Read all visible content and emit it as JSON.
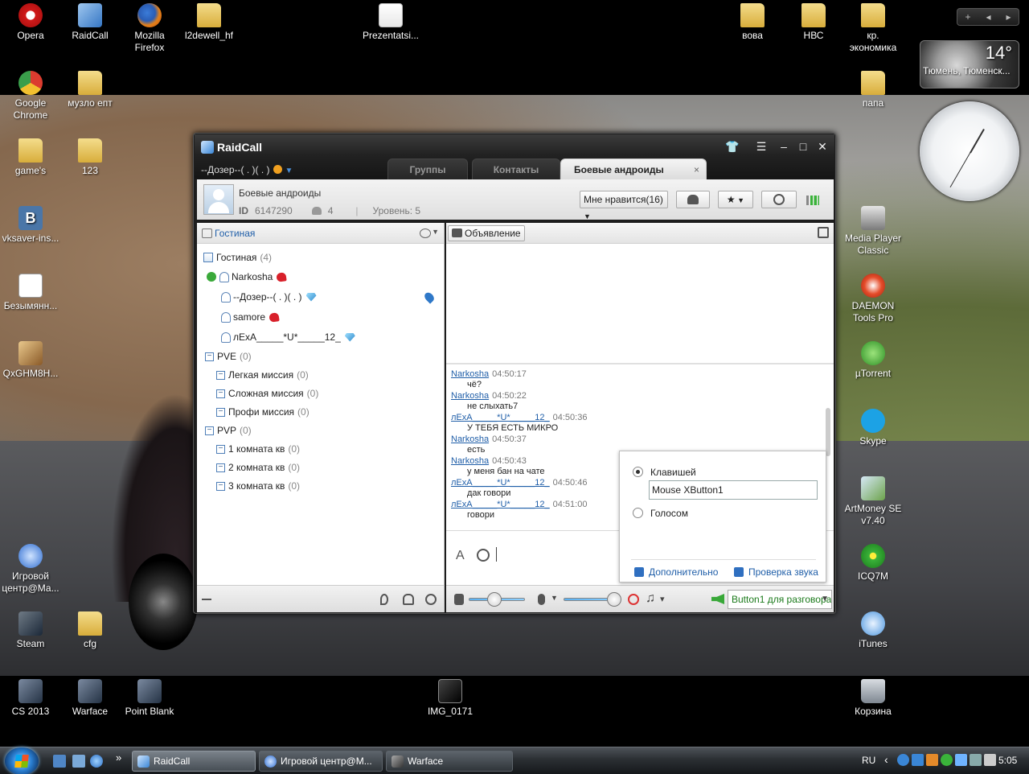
{
  "desktop": {
    "icons_left": [
      {
        "label": "Opera",
        "icon": "opera-icon"
      },
      {
        "label": "RaidCall",
        "icon": "raidcall-icon"
      },
      {
        "label": "Mozilla Firefox",
        "icon": "firefox-icon"
      },
      {
        "label": "l2dewell_hf",
        "icon": "folder-icon"
      },
      {
        "label": "Prezentatsi...",
        "icon": "powerpoint-file-icon"
      },
      {
        "label": "Google Chrome",
        "icon": "chrome-icon"
      },
      {
        "label": "музло епт",
        "icon": "folder-icon"
      },
      {
        "label": "game's",
        "icon": "folder-icon"
      },
      {
        "label": "123",
        "icon": "folder-icon"
      },
      {
        "label": "vksaver-ins...",
        "icon": "vk-icon"
      },
      {
        "label": "Безымянн...",
        "icon": "image-file-icon"
      },
      {
        "label": "QxGHM8H...",
        "icon": "image-file-icon"
      },
      {
        "label": "Игровой центр@Ма...",
        "icon": "game-center-icon"
      },
      {
        "label": "Steam",
        "icon": "steam-icon"
      },
      {
        "label": "cfg",
        "icon": "folder-icon"
      },
      {
        "label": "CS 2013",
        "icon": "cs-icon"
      },
      {
        "label": "Warface",
        "icon": "warface-icon"
      },
      {
        "label": "Point Blank",
        "icon": "point-blank-icon"
      },
      {
        "label": "IMG_0171",
        "icon": "video-file-icon"
      }
    ],
    "icons_right": [
      {
        "label": "вова",
        "icon": "folder-icon"
      },
      {
        "label": "НВС",
        "icon": "folder-icon"
      },
      {
        "label": "кр. экономика",
        "icon": "folder-icon"
      },
      {
        "label": "папа",
        "icon": "folder-icon"
      },
      {
        "label": "Media Player Classic",
        "icon": "mpc-icon"
      },
      {
        "label": "DAEMON Tools Pro",
        "icon": "daemon-tools-icon"
      },
      {
        "label": "µTorrent",
        "icon": "utorrent-icon"
      },
      {
        "label": "Skype",
        "icon": "skype-icon"
      },
      {
        "label": "ArtMoney SE v7.40",
        "icon": "artmoney-icon"
      },
      {
        "label": "ICQ7M",
        "icon": "icq-icon"
      },
      {
        "label": "iTunes",
        "icon": "itunes-icon"
      },
      {
        "label": "Корзина",
        "icon": "recycle-bin-icon"
      }
    ]
  },
  "gadgets": {
    "weather": {
      "temperature": "14°",
      "city": "Тюмень, Тюменск..."
    },
    "controls": {
      "add": "+",
      "prev": "◂",
      "next": "▸"
    }
  },
  "taskbar": {
    "quicklaunch_more": "»",
    "buttons": [
      {
        "label": "RaidCall",
        "active": true
      },
      {
        "label": "Игровой центр@М...",
        "active": false
      },
      {
        "label": "Warface",
        "active": false
      }
    ],
    "lang": "RU",
    "tray_arrow": "‹",
    "clock": "5:05"
  },
  "raidcall": {
    "app_name": "RaidCall",
    "user_nick": "--Дозер--( . )( . )",
    "tabs": [
      {
        "label": "Группы",
        "active": false
      },
      {
        "label": "Контакты",
        "active": false
      },
      {
        "label": "Боевые андроиды",
        "active": true
      }
    ],
    "tab_close": "×",
    "window_buttons": {
      "skin": "👕",
      "menu": "☰",
      "minimize": "–",
      "maximize": "□",
      "close": "✕"
    },
    "channel": {
      "name": "Боевые андроиды",
      "id_label": "ID",
      "id": "6147290",
      "members": "4",
      "level": "Уровень: 5",
      "like_button": "Мне нравится(16)"
    },
    "left_bar_label": "Гостиная",
    "tree": {
      "lobby": {
        "label": "Гостиная",
        "count": "(4)"
      },
      "users": [
        {
          "name": "Narkosha",
          "badge": "heart"
        },
        {
          "name": "--Дозер--( . )( . )",
          "badge": "gem"
        },
        {
          "name": "samore",
          "badge": "heart"
        },
        {
          "name": "лExA_____*U*_____12_",
          "badge": "gem"
        }
      ],
      "groups": [
        {
          "label": "PVE",
          "count": "(0)",
          "level": 0
        },
        {
          "label": "Легкая миссия",
          "count": "(0)",
          "level": 1
        },
        {
          "label": "Сложная миссия",
          "count": "(0)",
          "level": 1
        },
        {
          "label": "Профи миссия",
          "count": "(0)",
          "level": 1
        },
        {
          "label": "PVP",
          "count": "(0)",
          "level": 0
        },
        {
          "label": "1 комната кв",
          "count": "(0)",
          "level": 1
        },
        {
          "label": "2 комната кв",
          "count": "(0)",
          "level": 1
        },
        {
          "label": "3 комната кв",
          "count": "(0)",
          "level": 1
        }
      ]
    },
    "announcement_button": "Объявление",
    "chat": [
      {
        "who": "Narkosha",
        "time": "04:50:17",
        "text": "чё?"
      },
      {
        "who": "Narkosha",
        "time": "04:50:22",
        "text": "не слыхать7"
      },
      {
        "who": "лExA_____*U*_____12_",
        "time": "04:50:36",
        "text": "У ТЕБЯ ЕСТЬ МИКРО"
      },
      {
        "who": "Narkosha",
        "time": "04:50:37",
        "text": "есть"
      },
      {
        "who": "Narkosha",
        "time": "04:50:43",
        "text": "у меня бан на чате"
      },
      {
        "who": "лExA_____*U*_____12_",
        "time": "04:50:46",
        "text": "дак говори"
      },
      {
        "who": "лExA_____*U*_____12_",
        "time": "04:51:00",
        "text": "говори"
      }
    ],
    "input_font_icon": "A",
    "volume_level": 0.45,
    "mic_level": 0.9,
    "music_dd": "▾",
    "ptt_select": "Button1 для разговора",
    "popup": {
      "option_key": "Клавишей",
      "hotkey_value": "Mouse XButton1",
      "option_voice": "Голосом",
      "link_advanced": "Дополнительно",
      "link_sound_check": "Проверка звука"
    }
  }
}
